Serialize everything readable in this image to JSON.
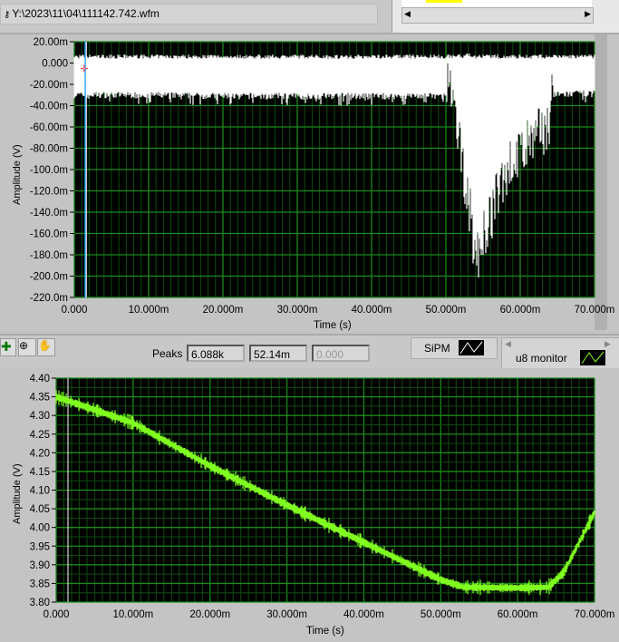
{
  "file_path": "Y:\\2023\\11\\04\\111142.742.wfm",
  "colors": {
    "plot_bg": "#000000",
    "grid_major": "#1a8a1a",
    "grid_minor": "#0d4d0d",
    "sipm_trace": "#ffffff",
    "u8_trace": "#80ff20"
  },
  "toolbar": {
    "peaks_label": "Peaks",
    "peak_values": [
      "6.088k",
      "52.14m",
      "0.000"
    ],
    "sipm_label": "SiPM",
    "u8_label": "u8 monitor"
  },
  "chart_data": [
    {
      "type": "line",
      "title": "SiPM",
      "xlabel": "Time (s)",
      "ylabel": "Amplitude (V)",
      "xlim": [
        0,
        0.07
      ],
      "ylim": [
        -0.22,
        0.02
      ],
      "x_ticks": [
        "0.000",
        "10.000m",
        "20.000m",
        "30.000m",
        "40.000m",
        "50.000m",
        "60.000m",
        "70.000m"
      ],
      "y_ticks": [
        "20.00m",
        "0.000",
        "-20.00m",
        "-40.00m",
        "-60.00m",
        "-80.00m",
        "-100.0m",
        "-120.0m",
        "-140.0m",
        "-160.0m",
        "-180.0m",
        "-200.0m",
        "-220.0m"
      ],
      "series": [
        {
          "name": "SiPM",
          "x": [
            0,
            0.01,
            0.02,
            0.03,
            0.04,
            0.05,
            0.053,
            0.054,
            0.056,
            0.058,
            0.06,
            0.062,
            0.064,
            0.0645,
            0.07
          ],
          "y_min": [
            -0.03,
            -0.03,
            -0.031,
            -0.031,
            -0.031,
            -0.031,
            -0.15,
            -0.21,
            -0.17,
            -0.125,
            -0.11,
            -0.095,
            -0.08,
            -0.03,
            -0.028
          ],
          "y_max": [
            0.004,
            0.004,
            0.004,
            0.004,
            0.004,
            0.004,
            0.005,
            0.004,
            0.004,
            0.004,
            0.004,
            0.004,
            0.004,
            0.004,
            0.004
          ]
        }
      ],
      "cursor_x": 0.0015
    },
    {
      "type": "line",
      "title": "u8 monitor",
      "xlabel": "Time (s)",
      "ylabel": "Amplitude (V)",
      "xlim": [
        0,
        0.07
      ],
      "ylim": [
        3.8,
        4.4
      ],
      "x_ticks": [
        "0.000",
        "10.000m",
        "20.000m",
        "30.000m",
        "40.000m",
        "50.000m",
        "60.000m",
        "70.000m"
      ],
      "y_ticks": [
        "4.40",
        "4.35",
        "4.30",
        "4.25",
        "4.20",
        "4.15",
        "4.10",
        "4.05",
        "4.00",
        "3.95",
        "3.90",
        "3.85",
        "3.80"
      ],
      "series": [
        {
          "name": "u8 monitor",
          "x": [
            0,
            0.01,
            0.02,
            0.03,
            0.04,
            0.05,
            0.053,
            0.06,
            0.064,
            0.066,
            0.068,
            0.07
          ],
          "y": [
            4.35,
            4.28,
            4.165,
            4.06,
            3.96,
            3.86,
            3.84,
            3.838,
            3.84,
            3.88,
            3.96,
            4.04
          ]
        }
      ]
    }
  ]
}
